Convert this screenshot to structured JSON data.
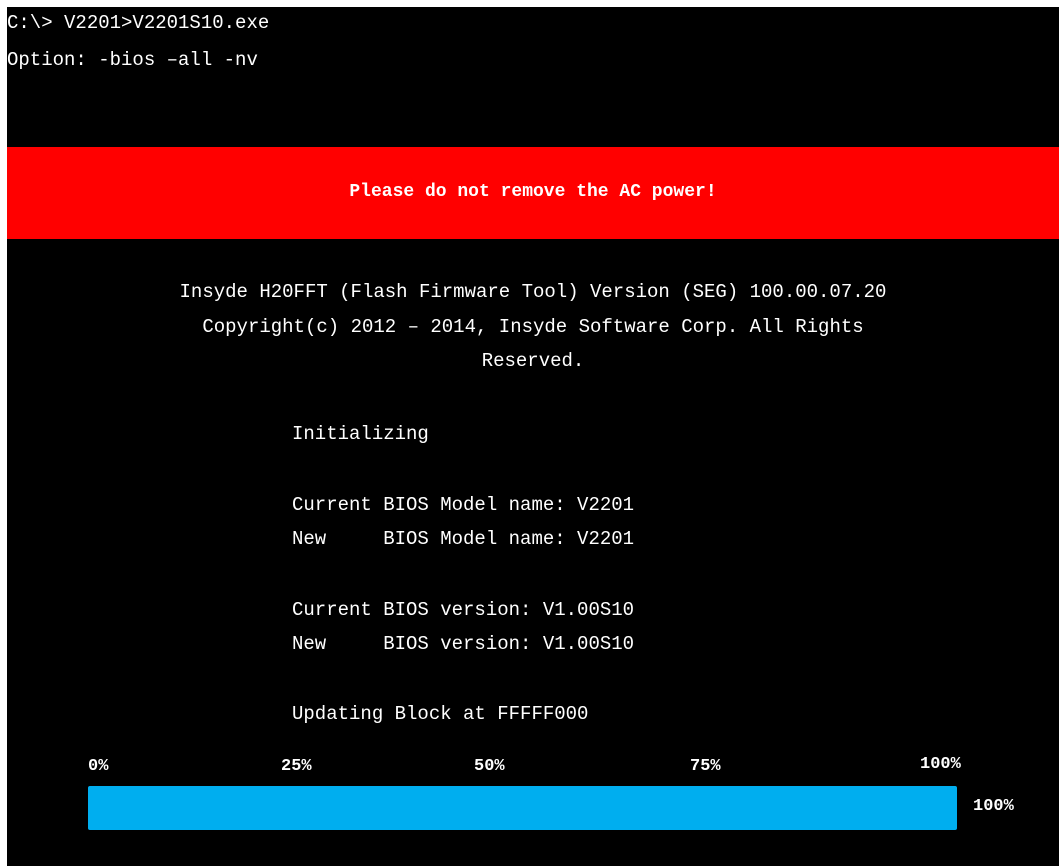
{
  "terminal": {
    "command_line": "C:\\> V2201>V2201S10.exe",
    "option_line": "Option: -bios –all -nv"
  },
  "warning": {
    "text": "Please do not remove the AC power!",
    "color": "#ff0000"
  },
  "header": {
    "title": "Insyde H20FFT (Flash Firmware Tool) Version (SEG) 100.00.07.20",
    "copyright_line1": "Copyright(c) 2012 – 2014, Insyde Software Corp. All Rights",
    "copyright_line2": "Reserved."
  },
  "status": {
    "initializing": "Initializing",
    "current_model": "Current BIOS Model name: V2201",
    "new_model": "New     BIOS Model name: V2201",
    "current_version": "Current BIOS version: V1.00S10",
    "new_version": "New     BIOS version: V1.00S10",
    "updating": "Updating Block at FFFFF000"
  },
  "progress": {
    "ticks": [
      "0%",
      "25%",
      "50%",
      "75%",
      "100%"
    ],
    "value_fraction": 1.0,
    "percent_label": "100%",
    "bar_color": "#00aeef"
  }
}
